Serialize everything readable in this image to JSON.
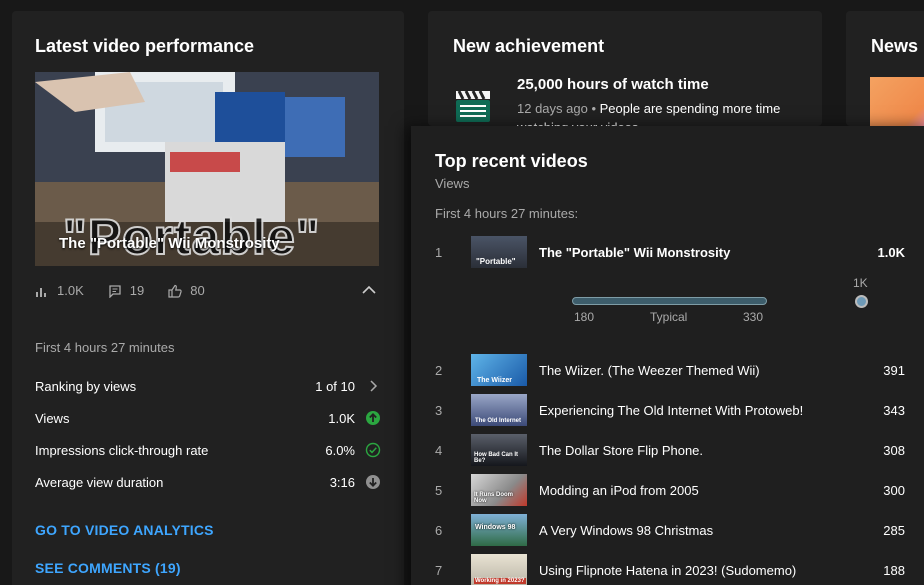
{
  "latest": {
    "title": "Latest video performance",
    "thumbnail_caption": "The \"Portable\" Wii Monstrosity",
    "thumbnail_text": "\"Portable\"",
    "stats": {
      "views": "1.0K",
      "comments": "19",
      "likes": "80"
    },
    "first_label": "First 4 hours 27 minutes",
    "metrics": [
      {
        "label": "Ranking by views",
        "value": "1 of 10",
        "icon": "chevron-right-icon"
      },
      {
        "label": "Views",
        "value": "1.0K",
        "icon": "arrow-up-circle-icon",
        "color": "#2ba640"
      },
      {
        "label": "Impressions click-through rate",
        "value": "6.0%",
        "icon": "check-circle-icon",
        "color": "#2ba640"
      },
      {
        "label": "Average view duration",
        "value": "3:16",
        "icon": "arrow-down-circle-icon",
        "color": "#909090"
      }
    ],
    "links": {
      "analytics": "GO TO VIDEO ANALYTICS",
      "comments": "SEE COMMENTS (19)"
    }
  },
  "achievement": {
    "title": "New achievement",
    "headline": "25,000 hours of watch time",
    "time": "12 days ago",
    "description": "People are spending more time watching your videos"
  },
  "news": {
    "title": "News"
  },
  "top_videos": {
    "title": "Top recent videos",
    "subtitle": "Views",
    "first_label": "First 4 hours 27 minutes:",
    "typical": {
      "low": "180",
      "label": "Typical",
      "high": "330",
      "current": "1K"
    },
    "rows": [
      {
        "rank": "1",
        "title": "The \"Portable\" Wii Monstrosity",
        "views": "1.0K",
        "thumb_text": "\"Portable\""
      },
      {
        "rank": "2",
        "title": "The Wiizer. (The Weezer Themed Wii)",
        "views": "391",
        "thumb_text": "The Wiizer"
      },
      {
        "rank": "3",
        "title": "Experiencing The Old Internet With Protoweb!",
        "views": "343",
        "thumb_text": "The Old Internet"
      },
      {
        "rank": "4",
        "title": "The Dollar Store Flip Phone.",
        "views": "308",
        "thumb_text": "How Bad Can It Be?"
      },
      {
        "rank": "5",
        "title": "Modding an iPod from 2005",
        "views": "300",
        "thumb_text": "It Runs Doom Now"
      },
      {
        "rank": "6",
        "title": "A Very Windows 98 Christmas",
        "views": "285",
        "thumb_text": "Windows 98"
      },
      {
        "rank": "7",
        "title": "Using Flipnote Hatena in 2023! (Sudomemo)",
        "views": "188",
        "thumb_text": "Working in 2023?"
      }
    ]
  },
  "colors": {
    "link": "#3ea6ff",
    "card": "#212121",
    "background": "#181818",
    "positive": "#2ba640"
  }
}
